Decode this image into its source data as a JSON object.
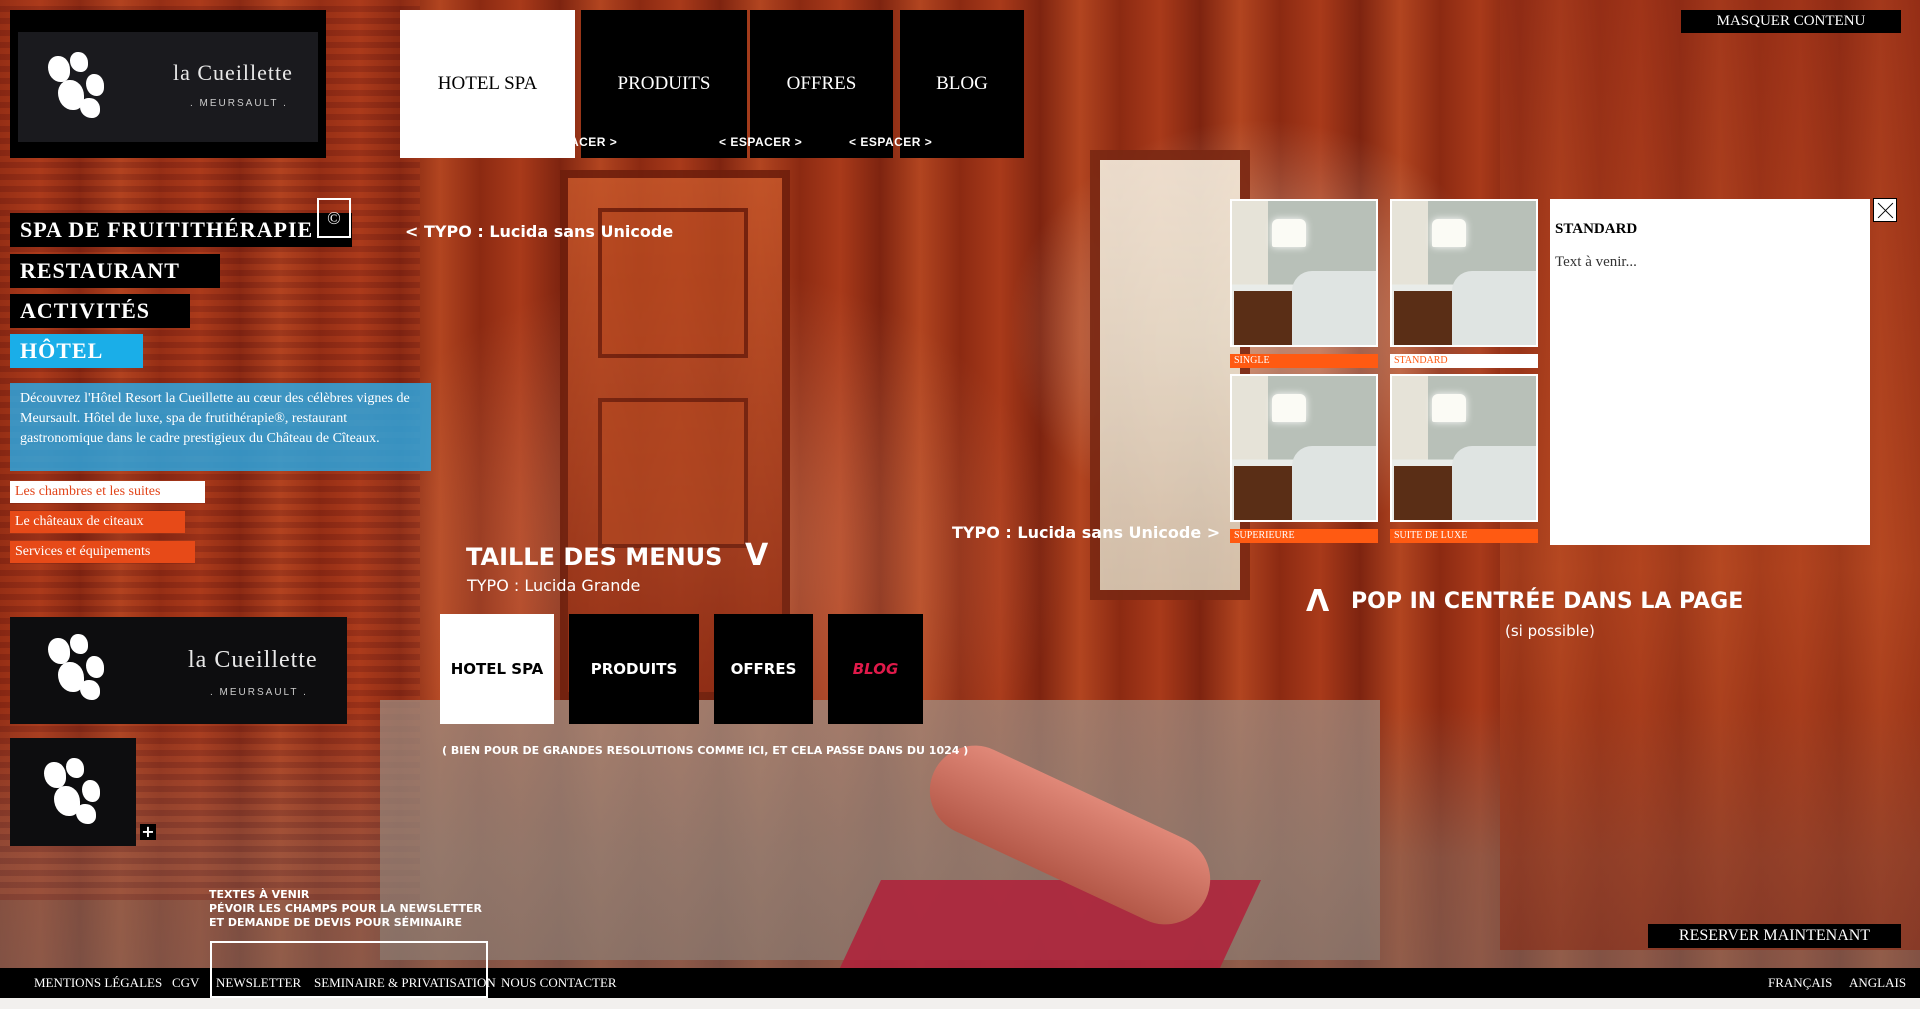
{
  "brand": {
    "name": "la Cueillette",
    "location": ". MEURSAULT ."
  },
  "topnav": [
    {
      "label": "HOTEL SPA"
    },
    {
      "label": "PRODUITS"
    },
    {
      "label": "OFFRES"
    },
    {
      "label": "BLOG"
    }
  ],
  "espacer": "< ESPACER >",
  "masquer": "MASQUER CONTENU",
  "leftmenu": {
    "items": [
      {
        "label": "SPA DE FRUITITHÉRAPIE"
      },
      {
        "label": "RESTAURANT"
      },
      {
        "label": "ACTIVITÉS"
      },
      {
        "label": "HÔTEL"
      }
    ],
    "copyright": "©",
    "intro": "Découvrez l'Hôtel Resort la Cueillette au cœur des célèbres vignes de Meursault. Hôtel de luxe, spa de frutithérapie®, restaurant gastronomique dans le cadre prestigieux du Château de Cîteaux.",
    "sublinks": [
      {
        "label": "Les chambres et les suites"
      },
      {
        "label": "Le châteaux de citeaux"
      },
      {
        "label": "Services et équipements"
      }
    ]
  },
  "annotations": {
    "typo_left": "< TYPO : Lucida sans Unicode",
    "typo_right": "TYPO : Lucida sans Unicode >",
    "taille_title": "TAILLE DES MENUS",
    "taille_chevron": "V",
    "taille_typo": "TYPO : Lucida Grande",
    "resolution_note": "( BIEN POUR DE GRANDES RESOLUTIONS COMME ICI, ET CELA PASSE DANS DU 1024 )",
    "popin_title": "POP IN CENTRÉE DANS LA PAGE",
    "popin_chevron": "Λ",
    "popin_sub": "(si possible)",
    "textes_line1": "TEXTES À VENIR",
    "textes_line2": "PÉVOIR LES CHAMPS POUR LA NEWSLETTER",
    "textes_line3": "ET DEMANDE DE DEVIS POUR SÉMINAIRE",
    "plus": "+"
  },
  "menu_sample": [
    {
      "label": "HOTEL SPA"
    },
    {
      "label": "PRODUITS"
    },
    {
      "label": "OFFRES"
    },
    {
      "label": "BLOG"
    }
  ],
  "rooms": [
    {
      "label": "SINGLE"
    },
    {
      "label": "STANDARD"
    },
    {
      "label": "SUPERIEURE"
    },
    {
      "label": "SUITE DE LUXE"
    }
  ],
  "popup": {
    "title": "STANDARD",
    "body": "Text à venir..."
  },
  "reserver": "RESERVER MAINTENANT",
  "footer": {
    "links": [
      "MENTIONS LÉGALES",
      "CGV",
      "NEWSLETTER",
      "SEMINAIRE & PRIVATISATION",
      "NOUS CONTACTER"
    ],
    "languages": [
      "FRANÇAIS",
      "ANGLAIS"
    ]
  },
  "colors": {
    "accent_blue": "#1aaee8",
    "accent_orange": "#ff5a12",
    "blog_pink": "#e01a4a"
  }
}
